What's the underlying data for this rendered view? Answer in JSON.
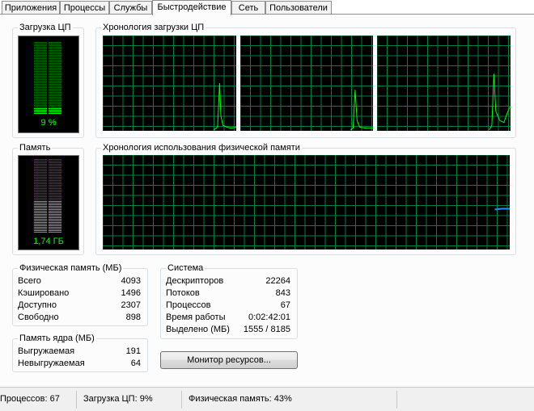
{
  "tabs": [
    {
      "label": "Приложения"
    },
    {
      "label": "Процессы"
    },
    {
      "label": "Службы"
    },
    {
      "label": "Быстродействие"
    },
    {
      "label": "Сеть"
    },
    {
      "label": "Пользователи"
    }
  ],
  "active_tab": "Быстродействие",
  "cpu": {
    "title": "Загрузка ЦП",
    "value_label": "9 %",
    "value": 0.09
  },
  "cpu_history": {
    "title": "Хронология загрузки ЦП"
  },
  "memory": {
    "title": "Память",
    "value_label": "1,74 ГБ",
    "value": 0.43
  },
  "memory_history": {
    "title": "Хронология использования физической памяти"
  },
  "physical_memory": {
    "title": "Физическая память (МБ)",
    "rows": [
      {
        "label": "Всего",
        "value": "4093"
      },
      {
        "label": "Кэшировано",
        "value": "1496"
      },
      {
        "label": "Доступно",
        "value": "2307"
      },
      {
        "label": "Свободно",
        "value": "898"
      }
    ]
  },
  "kernel_memory": {
    "title": "Память ядра (МБ)",
    "rows": [
      {
        "label": "Выгружаемая",
        "value": "191"
      },
      {
        "label": "Невыгружаемая",
        "value": "64"
      }
    ]
  },
  "system": {
    "title": "Система",
    "rows": [
      {
        "label": "Дескрипторов",
        "value": "22264"
      },
      {
        "label": "Потоков",
        "value": "843"
      },
      {
        "label": "Процессов",
        "value": "67"
      },
      {
        "label": "Время работы",
        "value": "0:02:42:01"
      },
      {
        "label": "Выделено (МБ)",
        "value": "1555 / 8185"
      }
    ]
  },
  "resource_monitor_button": "Монитор ресурсов...",
  "status": {
    "processes": "Процессов: 67",
    "cpu": "Загрузка ЦП: 9%",
    "memory": "Физическая память: 43%"
  },
  "colors": {
    "graph_bg": "#000000",
    "grid": "#008040",
    "line": "#00ff00",
    "meter_on": "#00ff00",
    "meter_off": "#006a00",
    "memory_line": "#1e90ff"
  }
}
